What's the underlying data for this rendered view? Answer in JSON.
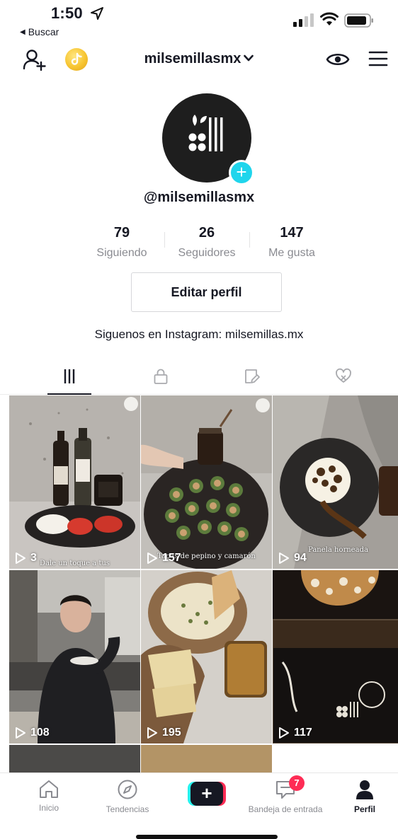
{
  "status_bar": {
    "time": "1:50",
    "back_label": "Buscar"
  },
  "header": {
    "account_name": "milsemillasmx"
  },
  "profile": {
    "username": "@milsemillasmx",
    "stats": [
      {
        "value": "79",
        "label": "Siguiendo"
      },
      {
        "value": "26",
        "label": "Seguidores"
      },
      {
        "value": "147",
        "label": "Me gusta"
      }
    ],
    "edit_button": "Editar perfil",
    "bio": "Siguenos en Instagram: milsemillas.mx"
  },
  "tabs": [
    {
      "icon": "videos-grid-icon",
      "active": true
    },
    {
      "icon": "lock-icon",
      "active": false
    },
    {
      "icon": "tagged-icon",
      "active": false
    },
    {
      "icon": "liked-icon",
      "active": false
    }
  ],
  "videos": [
    {
      "views": "3",
      "caption": "Dale un toque a tus"
    },
    {
      "views": "157",
      "caption": "Tapas de pepino y camarón"
    },
    {
      "views": "94",
      "caption": "Panela horneada"
    },
    {
      "views": "108",
      "caption": ""
    },
    {
      "views": "195",
      "caption": ""
    },
    {
      "views": "117",
      "caption": ""
    }
  ],
  "bottom_nav": [
    {
      "label": "Inicio",
      "icon": "home-icon"
    },
    {
      "label": "Tendencias",
      "icon": "compass-icon"
    },
    {
      "label": "",
      "icon": "create-plus-icon"
    },
    {
      "label": "Bandeja de entrada",
      "icon": "inbox-icon",
      "badge": "7"
    },
    {
      "label": "Perfil",
      "icon": "person-icon",
      "active": true
    }
  ],
  "colors": {
    "accent_cyan": "#25f4ee",
    "accent_red": "#fe2c55",
    "add_badge": "#20d5ec",
    "text": "#161823",
    "muted": "#8a8b91"
  }
}
